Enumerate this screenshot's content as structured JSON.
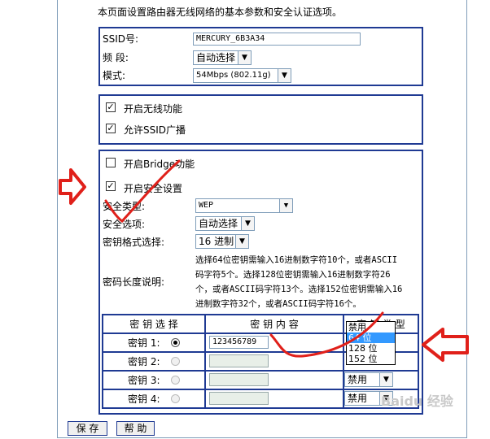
{
  "intro": "本页面设置路由器无线网络的基本参数和安全认证选项。",
  "basic": {
    "ssid_label": "SSID号:",
    "ssid_value": "MERCURY_6B3A34",
    "band_label": "频 段:",
    "band_value": "自动选择",
    "mode_label": "模式:",
    "mode_value": "54Mbps (802.11g)"
  },
  "wireless": {
    "enable_label": "开启无线功能",
    "broadcast_label": "允许SSID广播"
  },
  "security": {
    "bridge_label": "开启Bridge功能",
    "enable_security_label": "开启安全设置",
    "type_label": "安全类型:",
    "type_value": "WEP",
    "option_label": "安全选项:",
    "option_value": "自动选择",
    "format_label": "密钥格式选择:",
    "format_value": "16 进制",
    "length_label": "密码长度说明:",
    "length_desc_1": "选择64位密钥需输入16进制数字符10个，或者ASCII",
    "length_desc_2": "码字符5个。选择128位密钥需输入16进制数字符26",
    "length_desc_3": "个，或者ASCII码字符13个。选择152位密钥需输入16",
    "length_desc_4": "进制数字符32个，或者ASCII码字符16个。"
  },
  "keys_table": {
    "col_select": "密 钥 选 择",
    "col_content": "密 钥 内 容",
    "col_type": "密 钥 类 型",
    "rows": [
      {
        "label": "密钥 1:",
        "value": "123456789",
        "type": "禁用"
      },
      {
        "label": "密钥 2:",
        "value": "",
        "type": "禁用"
      },
      {
        "label": "密钥 3:",
        "value": "",
        "type": "禁用"
      },
      {
        "label": "密钥 4:",
        "value": "",
        "type": "禁用"
      }
    ]
  },
  "dropdown_options": [
    "禁用",
    "64 位",
    "128 位",
    "152 位"
  ],
  "buttons": {
    "save": "保 存",
    "help": "帮 助"
  },
  "watermark": "Baidu 经验",
  "colors": {
    "border": "#1f3a93",
    "annotation": "#e0201a",
    "highlight": "#3399ff"
  }
}
